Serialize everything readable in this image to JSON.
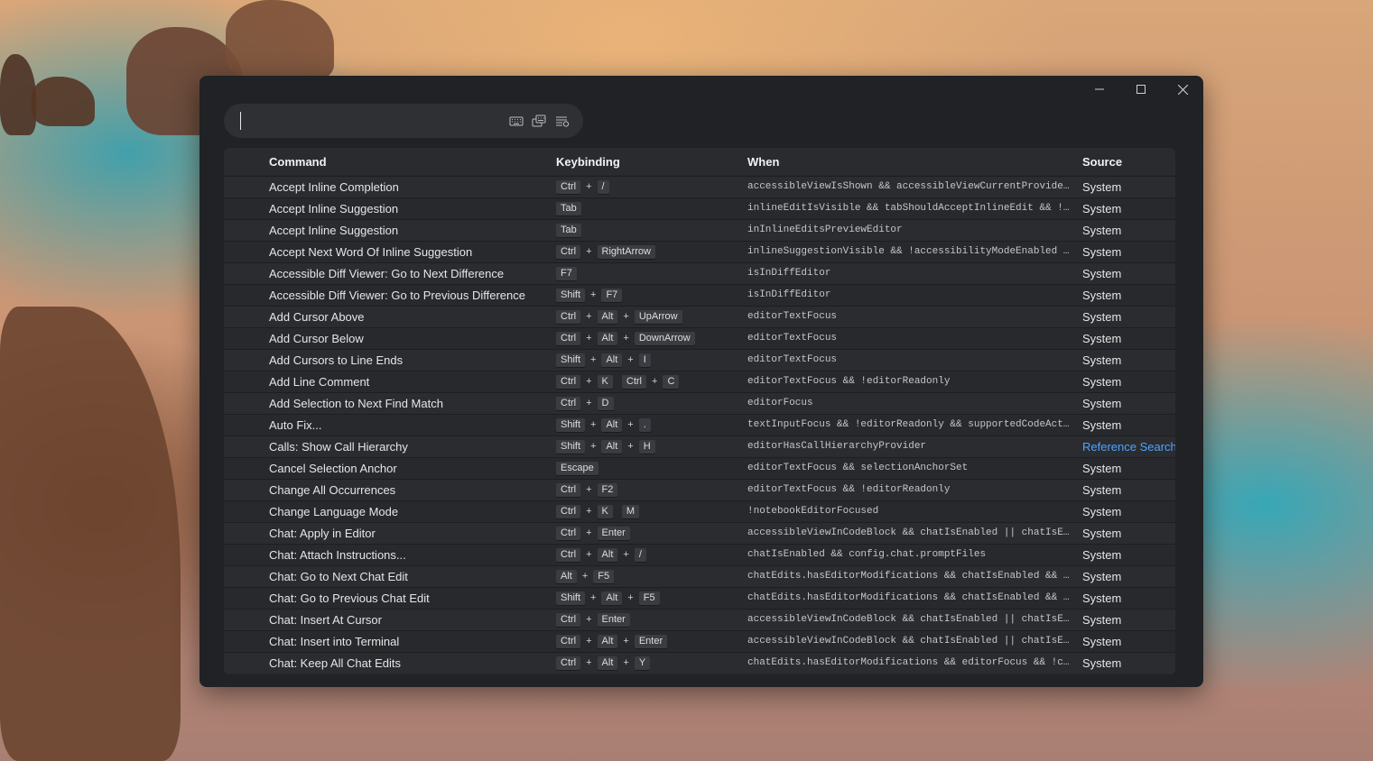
{
  "icons": {
    "minimize": "minimize-icon",
    "maximize": "maximize-icon",
    "close": "close-icon",
    "keyboard": "keyboard-icon",
    "record_keys": "record-keys-icon",
    "sort": "sort-by-precedence-icon"
  },
  "search": {
    "value": "",
    "placeholder": ""
  },
  "table": {
    "headers": {
      "command": "Command",
      "keybinding": "Keybinding",
      "when": "When",
      "source": "Source"
    },
    "rows": [
      {
        "command": "Accept Inline Completion",
        "keys": [
          [
            "Ctrl",
            "/"
          ]
        ],
        "when": "accessibleViewIsShown && accessibleViewCurrentProviderI...",
        "source": "System"
      },
      {
        "command": "Accept Inline Suggestion",
        "keys": [
          [
            "Tab"
          ]
        ],
        "when": "inlineEditIsVisible && tabShouldAcceptInlineEdit && !ed...",
        "source": "System"
      },
      {
        "command": "Accept Inline Suggestion",
        "keys": [
          [
            "Tab"
          ]
        ],
        "when": "inInlineEditsPreviewEditor",
        "source": "System"
      },
      {
        "command": "Accept Next Word Of Inline Suggestion",
        "keys": [
          [
            "Ctrl",
            "RightArrow"
          ]
        ],
        "when": "inlineSuggestionVisible && !accessibilityModeEnabled &&...",
        "source": "System"
      },
      {
        "command": "Accessible Diff Viewer: Go to Next Difference",
        "keys": [
          [
            "F7"
          ]
        ],
        "when": "isInDiffEditor",
        "source": "System"
      },
      {
        "command": "Accessible Diff Viewer: Go to Previous Difference",
        "keys": [
          [
            "Shift",
            "F7"
          ]
        ],
        "when": "isInDiffEditor",
        "source": "System"
      },
      {
        "command": "Add Cursor Above",
        "keys": [
          [
            "Ctrl",
            "Alt",
            "UpArrow"
          ]
        ],
        "when": "editorTextFocus",
        "source": "System"
      },
      {
        "command": "Add Cursor Below",
        "keys": [
          [
            "Ctrl",
            "Alt",
            "DownArrow"
          ]
        ],
        "when": "editorTextFocus",
        "source": "System"
      },
      {
        "command": "Add Cursors to Line Ends",
        "keys": [
          [
            "Shift",
            "Alt",
            "I"
          ]
        ],
        "when": "editorTextFocus",
        "source": "System"
      },
      {
        "command": "Add Line Comment",
        "keys": [
          [
            "Ctrl",
            "K"
          ],
          [
            "Ctrl",
            "C"
          ]
        ],
        "when": "editorTextFocus && !editorReadonly",
        "source": "System"
      },
      {
        "command": "Add Selection to Next Find Match",
        "keys": [
          [
            "Ctrl",
            "D"
          ]
        ],
        "when": "editorFocus",
        "source": "System"
      },
      {
        "command": "Auto Fix...",
        "keys": [
          [
            "Shift",
            "Alt",
            "."
          ]
        ],
        "when": "textInputFocus && !editorReadonly && supportedCodeActio...",
        "source": "System"
      },
      {
        "command": "Calls: Show Call Hierarchy",
        "keys": [
          [
            "Shift",
            "Alt",
            "H"
          ]
        ],
        "when": "editorHasCallHierarchyProvider",
        "source": "Reference Search View",
        "source_is_link": true
      },
      {
        "command": "Cancel Selection Anchor",
        "keys": [
          [
            "Escape"
          ]
        ],
        "when": "editorTextFocus && selectionAnchorSet",
        "source": "System"
      },
      {
        "command": "Change All Occurrences",
        "keys": [
          [
            "Ctrl",
            "F2"
          ]
        ],
        "when": "editorTextFocus && !editorReadonly",
        "source": "System"
      },
      {
        "command": "Change Language Mode",
        "keys": [
          [
            "Ctrl",
            "K"
          ],
          [
            "M"
          ]
        ],
        "when": "!notebookEditorFocused",
        "source": "System"
      },
      {
        "command": "Chat: Apply in Editor",
        "keys": [
          [
            "Ctrl",
            "Enter"
          ]
        ],
        "when": "accessibleViewInCodeBlock && chatIsEnabled || chatIsEna...",
        "source": "System"
      },
      {
        "command": "Chat: Attach Instructions...",
        "keys": [
          [
            "Ctrl",
            "Alt",
            "/"
          ]
        ],
        "when": "chatIsEnabled && config.chat.promptFiles",
        "source": "System"
      },
      {
        "command": "Chat: Go to Next Chat Edit",
        "keys": [
          [
            "Alt",
            "F5"
          ]
        ],
        "when": "chatEdits.hasEditorModifications && chatIsEnabled && ed...",
        "source": "System"
      },
      {
        "command": "Chat: Go to Previous Chat Edit",
        "keys": [
          [
            "Shift",
            "Alt",
            "F5"
          ]
        ],
        "when": "chatEdits.hasEditorModifications && chatIsEnabled && ed...",
        "source": "System"
      },
      {
        "command": "Chat: Insert At Cursor",
        "keys": [
          [
            "Ctrl",
            "Enter"
          ]
        ],
        "when": "accessibleViewInCodeBlock && chatIsEnabled || chatIsEna...",
        "source": "System"
      },
      {
        "command": "Chat: Insert into Terminal",
        "keys": [
          [
            "Ctrl",
            "Alt",
            "Enter"
          ]
        ],
        "when": "accessibleViewInCodeBlock && chatIsEnabled || chatIsEna...",
        "source": "System"
      },
      {
        "command": "Chat: Keep All Chat Edits",
        "keys": [
          [
            "Ctrl",
            "Alt",
            "Y"
          ]
        ],
        "when": "chatEdits.hasEditorModifications && editorFocus && !cha...",
        "source": "System"
      }
    ]
  },
  "colors": {
    "window_bg": "#202225",
    "table_bg": "#26282b",
    "link": "#4ea3ff",
    "key_bg": "#3a3c41"
  }
}
